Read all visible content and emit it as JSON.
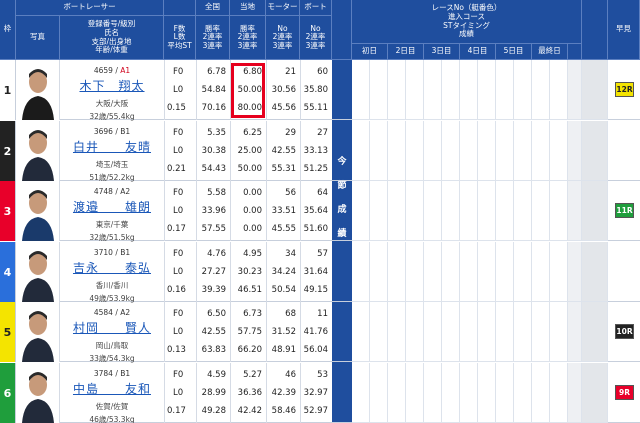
{
  "header": {
    "waku": "枠",
    "photo": "写真",
    "boat_racer": "ボートレーサー",
    "racer_info": [
      "登録番号/級別",
      "氏名",
      "支部/出身地",
      "年齢/体重"
    ],
    "fl": [
      "F数",
      "L数",
      "平均ST"
    ],
    "national": "全国",
    "local": "当地",
    "motor": "モーター",
    "boat": "ボート",
    "rates": [
      "勝率",
      "2連率",
      "3連率"
    ],
    "no_rates": [
      "No",
      "2連率",
      "3連率"
    ],
    "race_info": [
      "レースNo（艇番色）",
      "進入コース",
      "STタイミング",
      "成績"
    ],
    "days": [
      "初日",
      "2日目",
      "3日目",
      "4日目",
      "5日目",
      "最終日"
    ],
    "hayami": "早見",
    "mid_label": [
      "今",
      "節",
      "成",
      "績"
    ]
  },
  "colors": {
    "header_bg": "#1f4e9e",
    "waku": [
      "#ffffff",
      "#222222",
      "#e8002a",
      "#2a6fdb",
      "#f4e400",
      "#1f9e3c"
    ],
    "highlight": "#e6001e"
  },
  "racers": [
    {
      "waku": "1",
      "reg": "4659",
      "cls": "A1",
      "name": "木下　翔太",
      "home": "大阪/大阪",
      "age": "32歳/55.4kg",
      "f": "F0",
      "l": "L0",
      "st": "0.15",
      "nat": [
        "6.78",
        "54.84",
        "70.16"
      ],
      "loc": [
        "6.80",
        "50.00",
        "80.00"
      ],
      "motor": [
        "21",
        "30.56",
        "45.56"
      ],
      "boat": [
        "60",
        "35.80",
        "55.11"
      ],
      "badge": "12R",
      "badge_bg": "#f4e400",
      "badge_fg": "#222222"
    },
    {
      "waku": "2",
      "reg": "3696",
      "cls": "B1",
      "name": "白井　　友晴",
      "home": "埼玉/埼玉",
      "age": "51歳/52.2kg",
      "f": "F0",
      "l": "L0",
      "st": "0.21",
      "nat": [
        "5.35",
        "30.38",
        "54.43"
      ],
      "loc": [
        "6.25",
        "25.00",
        "50.00"
      ],
      "motor": [
        "29",
        "42.55",
        "55.31"
      ],
      "boat": [
        "27",
        "33.13",
        "51.25"
      ],
      "badge": "",
      "badge_bg": "",
      "badge_fg": ""
    },
    {
      "waku": "3",
      "reg": "4748",
      "cls": "A2",
      "name": "渡邉　　雄朗",
      "home": "東京/千葉",
      "age": "32歳/51.5kg",
      "f": "F0",
      "l": "L0",
      "st": "0.17",
      "nat": [
        "5.58",
        "33.96",
        "57.55"
      ],
      "loc": [
        "0.00",
        "0.00",
        "0.00"
      ],
      "motor": [
        "56",
        "33.51",
        "45.55"
      ],
      "boat": [
        "64",
        "35.64",
        "51.60"
      ],
      "badge": "11R",
      "badge_bg": "#1f9e3c",
      "badge_fg": "#ffffff"
    },
    {
      "waku": "4",
      "reg": "3710",
      "cls": "B1",
      "name": "吉永　　泰弘",
      "home": "香川/香川",
      "age": "49歳/53.9kg",
      "f": "F0",
      "l": "L0",
      "st": "0.16",
      "nat": [
        "4.76",
        "27.27",
        "39.39"
      ],
      "loc": [
        "4.95",
        "30.23",
        "46.51"
      ],
      "motor": [
        "34",
        "34.24",
        "50.54"
      ],
      "boat": [
        "57",
        "31.64",
        "49.15"
      ],
      "badge": "",
      "badge_bg": "",
      "badge_fg": ""
    },
    {
      "waku": "5",
      "reg": "4584",
      "cls": "A2",
      "name": "村岡　　賢人",
      "home": "岡山/鳥取",
      "age": "33歳/54.3kg",
      "f": "F0",
      "l": "L0",
      "st": "0.13",
      "nat": [
        "6.50",
        "42.55",
        "63.83"
      ],
      "loc": [
        "6.73",
        "57.75",
        "66.20"
      ],
      "motor": [
        "68",
        "31.52",
        "48.91"
      ],
      "boat": [
        "11",
        "41.76",
        "56.04"
      ],
      "badge": "10R",
      "badge_bg": "#222222",
      "badge_fg": "#ffffff"
    },
    {
      "waku": "6",
      "reg": "3784",
      "cls": "B1",
      "name": "中島　　友和",
      "home": "佐賀/佐賀",
      "age": "46歳/53.3kg",
      "f": "F0",
      "l": "L0",
      "st": "0.17",
      "nat": [
        "4.59",
        "28.99",
        "49.28"
      ],
      "loc": [
        "5.27",
        "36.36",
        "42.42"
      ],
      "motor": [
        "46",
        "42.39",
        "58.46"
      ],
      "boat": [
        "53",
        "32.97",
        "52.97"
      ],
      "badge": "9R",
      "badge_bg": "#e8002a",
      "badge_fg": "#ffffff"
    }
  ]
}
